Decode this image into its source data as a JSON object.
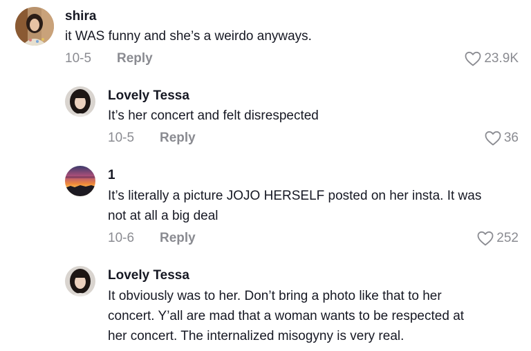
{
  "comments": [
    {
      "username": "shira",
      "lines": [
        "it WAS funny and she’s a weirdo anyways."
      ],
      "date": "10-5",
      "reply_label": "Reply",
      "likes": "23.9K",
      "avatar": "avatar-shira"
    },
    {
      "username": "Lovely Tessa",
      "lines": [
        "It’s her concert and felt disrespected"
      ],
      "date": "10-5",
      "reply_label": "Reply",
      "likes": "36",
      "avatar": "avatar-tessa"
    },
    {
      "username": "1",
      "lines": [
        "It’s literally a picture JOJO HERSELF posted on her insta. It was",
        "not at all a big deal"
      ],
      "date": "10-6",
      "reply_label": "Reply",
      "likes": "252",
      "avatar": "avatar-sunset"
    },
    {
      "username": "Lovely Tessa",
      "lines": [
        "It obviously was to her. Don’t bring a photo like that to her",
        "concert. Y’all are mad that a woman wants to be respected at",
        "her concert. The internalized misogyny is very real."
      ],
      "avatar": "avatar-tessa"
    }
  ],
  "icons": {
    "like": "heart-outline-icon"
  },
  "colors": {
    "text": "#161823",
    "secondary": "#8a8b91",
    "background": "#ffffff"
  }
}
